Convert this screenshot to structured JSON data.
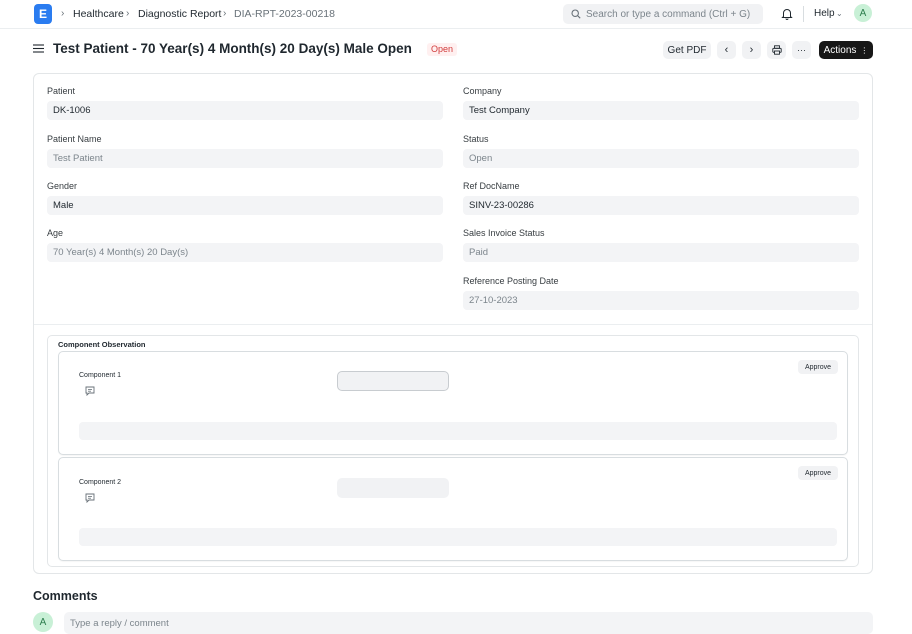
{
  "navbar": {
    "logo_letter": "E",
    "breadcrumbs": [
      "Healthcare",
      "Diagnostic Report",
      "DIA-RPT-2023-00218"
    ],
    "search_placeholder": "Search or type a command (Ctrl + G)",
    "help_label": "Help",
    "avatar_letter": "A"
  },
  "header": {
    "title": "Test Patient - 70 Year(s) 4 Month(s) 20 Day(s) Male Open",
    "status": "Open",
    "get_pdf_label": "Get PDF",
    "more_label": "···",
    "actions_label": "Actions"
  },
  "form": {
    "left": [
      {
        "label": "Patient",
        "value": "DK-1006",
        "readonly": false
      },
      {
        "label": "Patient Name",
        "value": "Test Patient",
        "readonly": true
      },
      {
        "label": "Gender",
        "value": "Male",
        "readonly": false
      },
      {
        "label": "Age",
        "value": "70 Year(s) 4 Month(s) 20 Day(s)",
        "readonly": true
      }
    ],
    "right": [
      {
        "label": "Company",
        "value": "Test Company",
        "readonly": false
      },
      {
        "label": "Status",
        "value": "Open",
        "readonly": true
      },
      {
        "label": "Ref DocName",
        "value": "SINV-23-00286",
        "readonly": false
      },
      {
        "label": "Sales Invoice Status",
        "value": "Paid",
        "readonly": true
      },
      {
        "label": "Reference Posting Date",
        "value": "27-10-2023",
        "readonly": true
      }
    ]
  },
  "observations": {
    "title": "Component Observation",
    "components": [
      {
        "label": "Component 1",
        "approve_label": "Approve"
      },
      {
        "label": "Component 2",
        "approve_label": "Approve"
      }
    ]
  },
  "comments": {
    "heading": "Comments",
    "avatar_letter": "A",
    "placeholder": "Type a reply / comment"
  }
}
